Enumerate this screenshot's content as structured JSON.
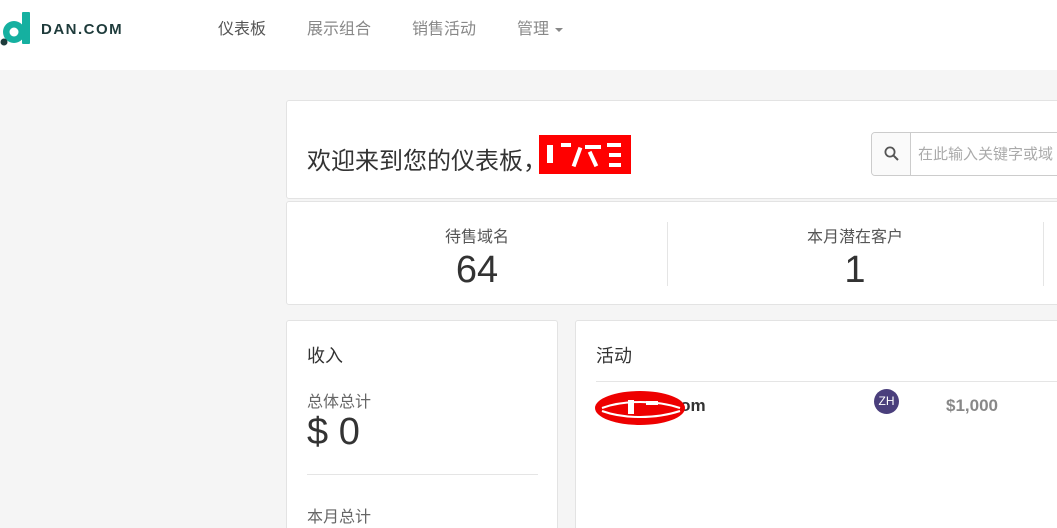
{
  "brand": {
    "name": "DAN.COM"
  },
  "nav": {
    "items": [
      {
        "label": "仪表板"
      },
      {
        "label": "展示组合"
      },
      {
        "label": "销售活动"
      },
      {
        "label": "管理"
      }
    ]
  },
  "welcome": {
    "title": "欢迎来到您的仪表板，"
  },
  "search": {
    "placeholder": "在此输入关键字或域"
  },
  "stats": [
    {
      "label": "待售域名",
      "value": "64"
    },
    {
      "label": "本月潜在客户",
      "value": "1"
    }
  ],
  "income": {
    "title": "收入",
    "total_label": "总体总计",
    "total_value": "$ 0",
    "month_label": "本月总计"
  },
  "activity": {
    "title": "活动",
    "items": [
      {
        "domain": ".com",
        "avatar": "ZH",
        "price": "$1,000"
      }
    ]
  },
  "colors": {
    "brand": "#1e3b3b",
    "redaction": "#ff0000",
    "avatar_bg": "#4a3f7c"
  }
}
